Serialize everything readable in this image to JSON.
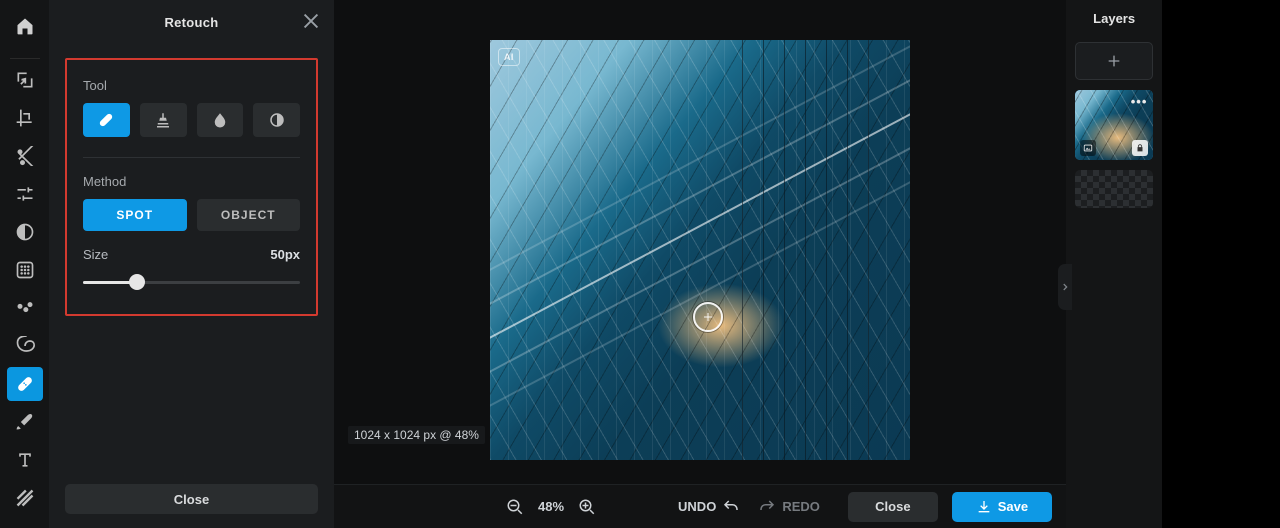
{
  "panel": {
    "title": "Retouch",
    "tool_label": "Tool",
    "method_label": "Method",
    "method_spot": "SPOT",
    "method_object": "OBJECT",
    "size_label": "Size",
    "size_value": "50px",
    "size_percent": 25,
    "close_label": "Close"
  },
  "bottom": {
    "zoom_text": "48%",
    "undo": "UNDO",
    "redo": "REDO",
    "close": "Close",
    "save": "Save"
  },
  "status": {
    "dimensions": "1024 x 1024 px @ 48%"
  },
  "layers": {
    "title": "Layers"
  },
  "ai_badge": "AI"
}
